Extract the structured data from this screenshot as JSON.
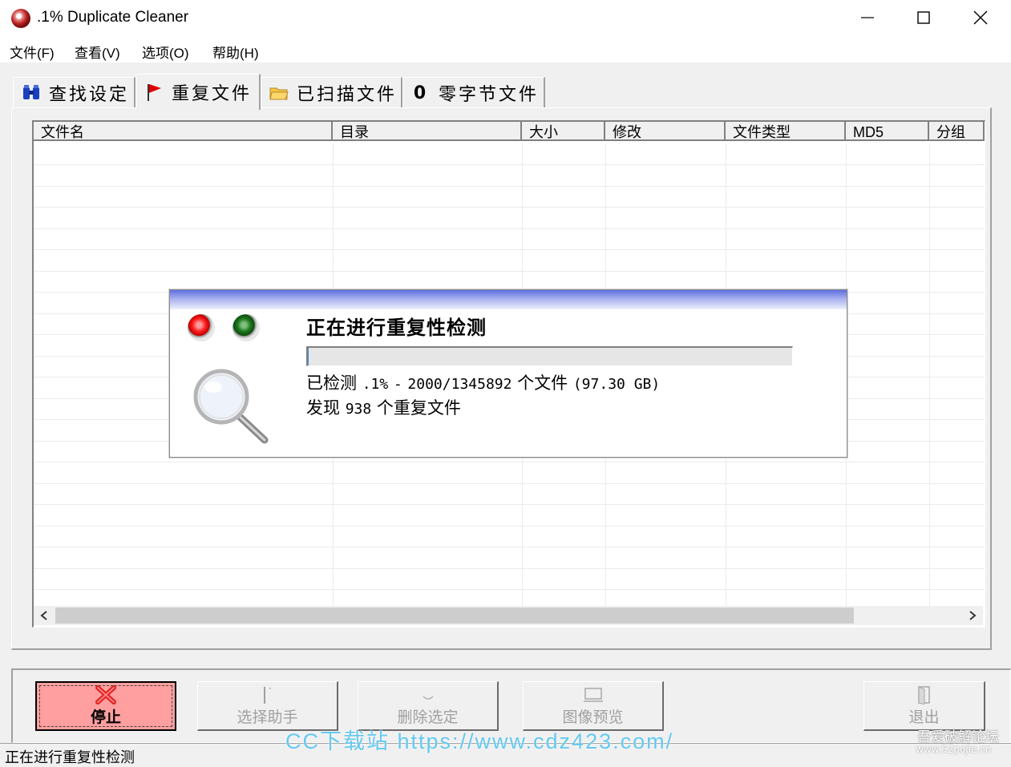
{
  "window": {
    "title": ".1% Duplicate Cleaner"
  },
  "menu": [
    "文件(F)",
    "查看(V)",
    "选项(O)",
    "帮助(H)"
  ],
  "tabs": [
    {
      "label": "查找设定",
      "icon": "binoculars-icon"
    },
    {
      "label": "重复文件",
      "icon": "red-flag-icon",
      "active": true
    },
    {
      "label": "已扫描文件",
      "icon": "folder-icon"
    },
    {
      "label": "零字节文件",
      "icon": "zero-icon",
      "icon_text": "0"
    }
  ],
  "grid": {
    "columns": [
      "文件名",
      "目录",
      "大小",
      "修改",
      "文件类型",
      "MD5",
      "分组"
    ],
    "rows": []
  },
  "dialog": {
    "title": "正在进行重复性检测",
    "progress_fraction": 0.001,
    "line1_prefix": "已检测",
    "line1_percent": ".1%",
    "line1_sep": "-",
    "line1_count": "2000/1345892",
    "line1_unit": "个文件",
    "line1_size": "(97.30 GB)",
    "line2_prefix": "发现",
    "line2_count": "938",
    "line2_suffix": "个重复文件"
  },
  "buttons": {
    "stop": "停止",
    "select_helper": "选择助手",
    "delete_selected": "删除选定",
    "image_preview": "图像预览",
    "exit": "退出"
  },
  "status": "正在进行重复性检测",
  "watermarks": {
    "cc": "CC下载站 https://www.cdz423.com/",
    "pojie_cn": "吾爱破解论坛",
    "pojie_url": "www.52pojie.cn"
  },
  "colors": {
    "stop_button": "#ff9f9f",
    "dialog_banner": "#5f6ee0",
    "led_red": "#ff2020",
    "led_green": "#1f7a1f"
  }
}
